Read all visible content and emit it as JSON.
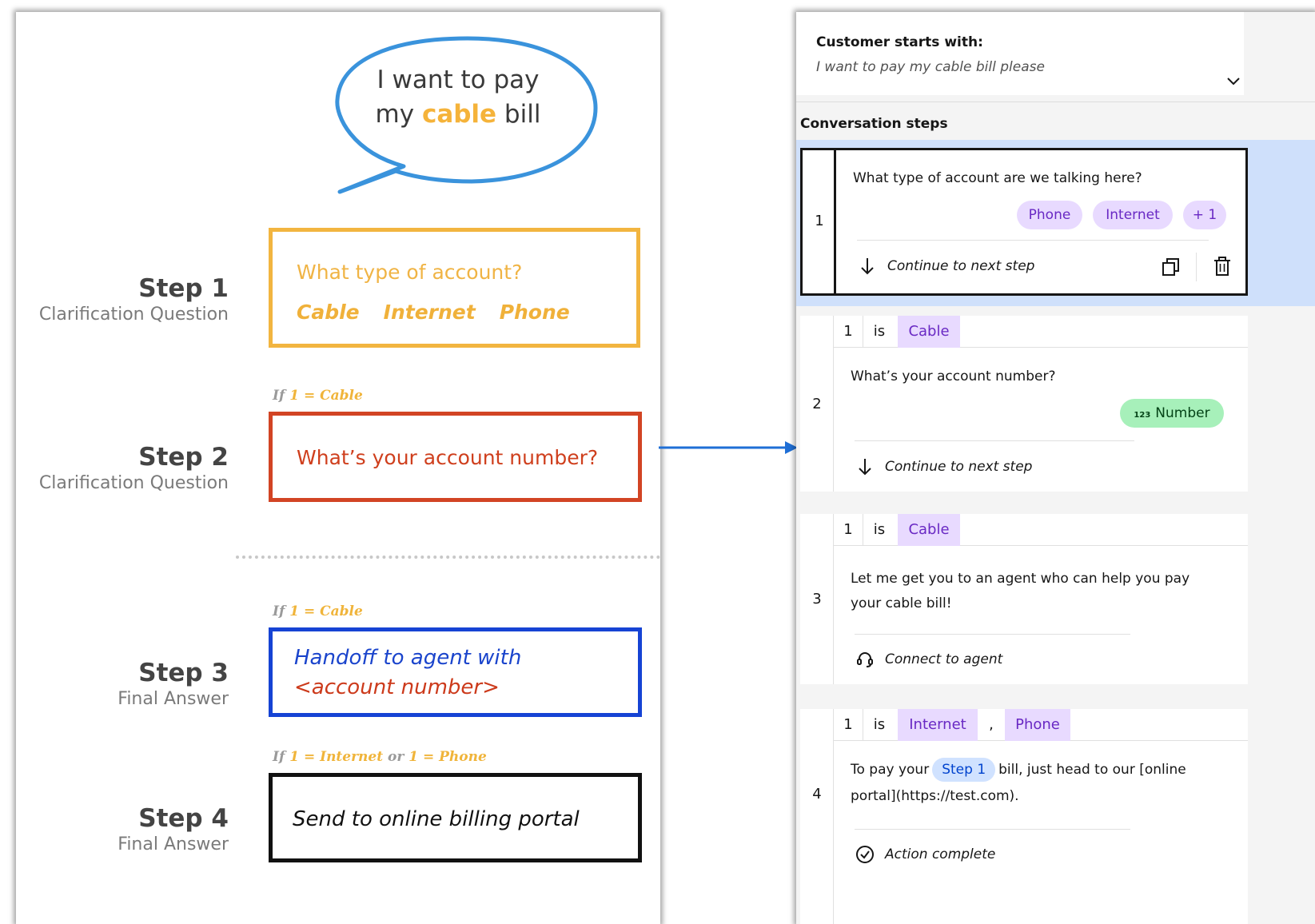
{
  "left": {
    "bubble": {
      "line1": "I want to pay",
      "line2_pre": "my ",
      "line2_hl": "cable",
      "line2_post": " bill"
    },
    "steps": [
      {
        "title": "Step 1",
        "subtitle": "Clarification Question"
      },
      {
        "title": "Step 2",
        "subtitle": "Clarification Question"
      },
      {
        "title": "Step 3",
        "subtitle": "Final Answer"
      },
      {
        "title": "Step 4",
        "subtitle": "Final Answer"
      }
    ],
    "box1": {
      "question": "What type of account?",
      "options": [
        "Cable",
        "Internet",
        "Phone"
      ]
    },
    "cond2": {
      "pre": "If ",
      "num": "1",
      "eq": " = Cable"
    },
    "box2": {
      "question": "What’s your account number?"
    },
    "cond3": {
      "pre": "If ",
      "num": "1",
      "eq": " = Cable"
    },
    "box3": {
      "line1": "Handoff to agent with",
      "line2": "<account number>"
    },
    "cond4": {
      "pre": "If ",
      "num1": "1",
      "eq1": " = Internet",
      "or": " or ",
      "num2": "1",
      "eq2": " = Phone"
    },
    "box4": {
      "text": "Send to online billing portal"
    }
  },
  "right": {
    "customer_title": "Customer starts with:",
    "customer_text": "I want to pay my cable bill please",
    "conversation_title": "Conversation steps",
    "step1": {
      "num": "1",
      "question": "What type of account are we talking here?",
      "options": [
        "Phone",
        "Internet",
        "+ 1"
      ],
      "action": "Continue to next step"
    },
    "step2": {
      "num": "2",
      "cond_num": "1",
      "cond_is": "is",
      "cond_val": "Cable",
      "question": "What’s your account number?",
      "response_icon": "123",
      "response": "Number",
      "action": "Continue to next step"
    },
    "step3": {
      "num": "3",
      "cond_num": "1",
      "cond_is": "is",
      "cond_val": "Cable",
      "line1": "Let me get you to an agent who can help you pay",
      "line2": "your cable bill!",
      "action": "Connect to agent"
    },
    "step4": {
      "num": "4",
      "cond_num": "1",
      "cond_is": "is",
      "cond_val1": "Internet",
      "cond_sep": ",",
      "cond_val2": "Phone",
      "text_pre": "To pay your",
      "step_ref": "Step 1",
      "text_post": "bill, just head to our [online",
      "line2": "portal](https://test.com).",
      "action": "Action complete"
    }
  },
  "colors": {
    "cable_orange": "#f2b540",
    "step2_red": "#d24424",
    "step3_blue": "#1643d4",
    "purple_tag": "#e8daff",
    "green_tag": "#a7f0ba",
    "selected_blue": "#cfe0fb"
  }
}
